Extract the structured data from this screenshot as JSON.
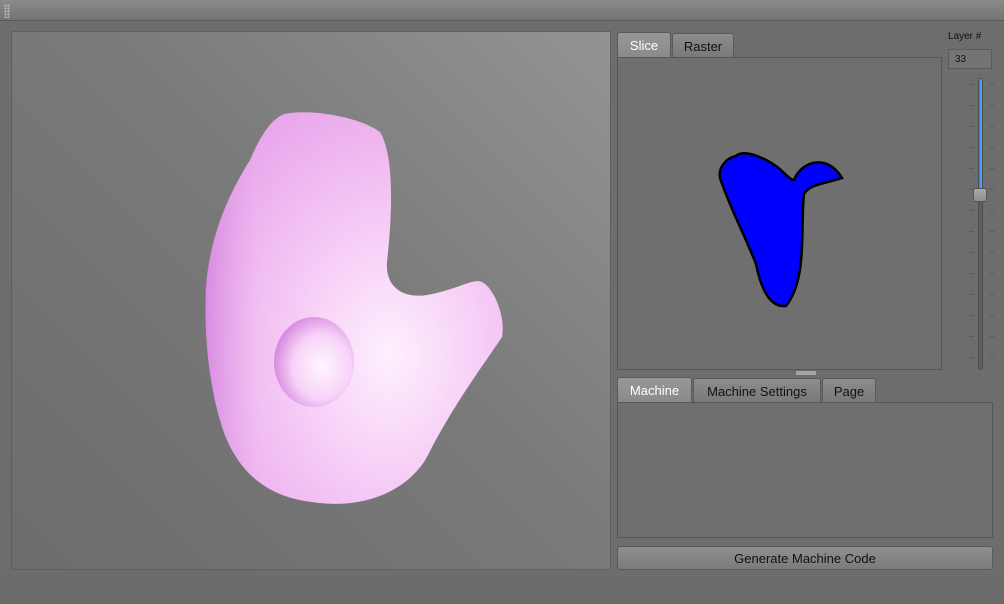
{
  "viewer": {
    "mesh_colors": {
      "light": "#fbe9fb",
      "mid": "#f0b7f0",
      "dark": "#c66fd3"
    },
    "background": {
      "light": "#939393",
      "dark": "#6c6c6c"
    }
  },
  "slice_tabs": [
    {
      "label": "Slice",
      "active": true
    },
    {
      "label": "Raster",
      "active": false
    }
  ],
  "slice_preview": {
    "fill_color": "#0000ff",
    "outline_color": "#000000"
  },
  "layer": {
    "label": "Layer #",
    "value": "33",
    "position_fraction": 0.4
  },
  "machine_tabs": [
    {
      "label": "Machine",
      "active": true
    },
    {
      "label": "Machine Settings",
      "active": false
    },
    {
      "label": "Page",
      "active": false
    }
  ],
  "generate_button": {
    "label": "Generate Machine Code"
  }
}
